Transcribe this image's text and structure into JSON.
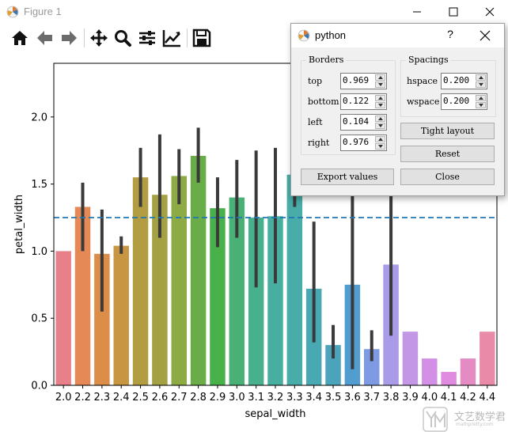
{
  "window": {
    "title": "Figure 1"
  },
  "toolbar": {
    "tools": [
      {
        "name": "home-icon",
        "tooltip": "Home"
      },
      {
        "name": "back-arrow-icon",
        "tooltip": "Back"
      },
      {
        "name": "forward-arrow-icon",
        "tooltip": "Forward"
      },
      {
        "name": "pan-move-icon",
        "tooltip": "Pan"
      },
      {
        "name": "zoom-magnifier-icon",
        "tooltip": "Zoom"
      },
      {
        "name": "subplots-sliders-icon",
        "tooltip": "Subplots"
      },
      {
        "name": "edit-axes-icon",
        "tooltip": "Customize"
      },
      {
        "name": "save-floppy-icon",
        "tooltip": "Save"
      }
    ]
  },
  "dialog": {
    "title": "python",
    "help_label": "?",
    "borders": {
      "title": "Borders",
      "fields": [
        {
          "label": "top",
          "value": "0.969"
        },
        {
          "label": "bottom",
          "value": "0.122"
        },
        {
          "label": "left",
          "value": "0.104"
        },
        {
          "label": "right",
          "value": "0.976"
        }
      ]
    },
    "spacings": {
      "title": "Spacings",
      "fields": [
        {
          "label": "hspace",
          "value": "0.200"
        },
        {
          "label": "wspace",
          "value": "0.200"
        }
      ]
    },
    "buttons": {
      "tight_layout": "Tight layout",
      "reset": "Reset",
      "close": "Close",
      "export": "Export values"
    }
  },
  "watermark": {
    "text": "文艺数学君",
    "sub": "mathpretty.com"
  },
  "chart_data": {
    "type": "bar",
    "xlabel": "sepal_width",
    "ylabel": "petal_width",
    "ylim": [
      0,
      2.4
    ],
    "yticks": [
      "0.0",
      "0.5",
      "1.0",
      "1.5",
      "2.0"
    ],
    "categories": [
      "2.0",
      "2.2",
      "2.3",
      "2.4",
      "2.5",
      "2.6",
      "2.7",
      "2.8",
      "2.9",
      "3.0",
      "3.1",
      "3.2",
      "3.3",
      "3.4",
      "3.5",
      "3.6",
      "3.7",
      "3.8",
      "3.9",
      "4.0",
      "4.1",
      "4.2",
      "4.4"
    ],
    "values": [
      1.0,
      1.33,
      0.98,
      1.04,
      1.55,
      1.42,
      1.56,
      1.71,
      1.32,
      1.4,
      1.25,
      1.26,
      1.57,
      0.72,
      0.3,
      0.75,
      0.27,
      0.9,
      0.4,
      0.2,
      0.1,
      0.2,
      0.4
    ],
    "ci_low": [
      1.0,
      1.0,
      0.55,
      0.98,
      1.33,
      1.1,
      1.35,
      1.51,
      1.03,
      1.1,
      0.73,
      0.76,
      1.33,
      0.32,
      0.2,
      0.12,
      0.18,
      0.37,
      0.4,
      0.2,
      0.1,
      0.2,
      0.4
    ],
    "ci_high": [
      1.0,
      1.51,
      1.31,
      1.11,
      1.77,
      1.87,
      1.76,
      1.92,
      1.55,
      1.68,
      1.75,
      1.77,
      1.8,
      1.22,
      0.45,
      1.5,
      0.41,
      1.5,
      0.4,
      0.2,
      0.1,
      0.2,
      0.4
    ],
    "hline": 1.25,
    "colors": [
      "#e8808b",
      "#e58a57",
      "#dc8d48",
      "#c89542",
      "#b39d43",
      "#a3a143",
      "#8eaa44",
      "#6aac47",
      "#48b14a",
      "#49b175",
      "#49b08e",
      "#48ae9f",
      "#48aca8",
      "#49a9b3",
      "#4ba3bc",
      "#529dd0",
      "#7d9ae2",
      "#a99be7",
      "#c497e6",
      "#d38fe6",
      "#e08ae0",
      "#e48bc4",
      "#e88aa8"
    ],
    "bar_color_extra": "#3a3a3a",
    "hline_color": "#1f77b4"
  }
}
